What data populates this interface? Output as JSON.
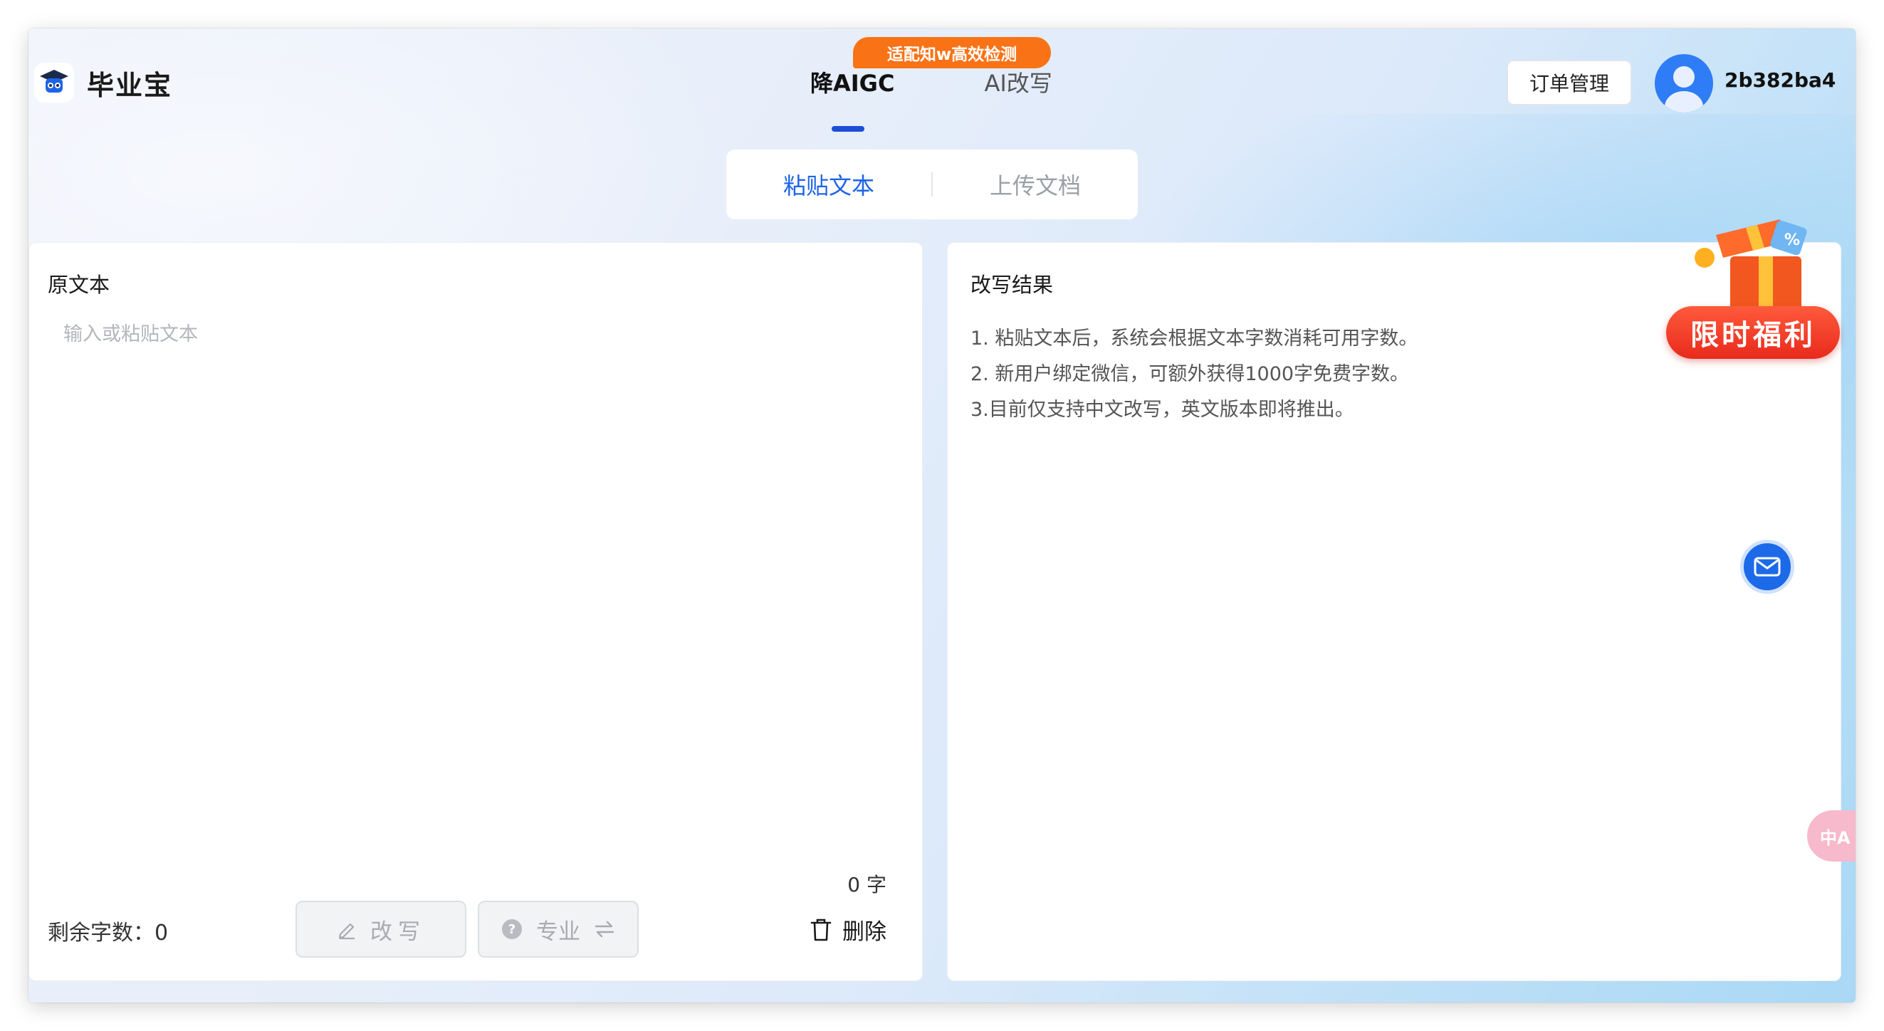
{
  "header": {
    "logo_text": "毕业宝",
    "nav": [
      {
        "label": "降AIGC",
        "active": true
      },
      {
        "label": "AI改写",
        "active": false
      }
    ],
    "promo_badge": "适配知w高效检测",
    "order_button": "订单管理",
    "username": "2b382ba4"
  },
  "mode_switch": {
    "paste": "粘贴文本",
    "upload": "上传文档",
    "active": "paste"
  },
  "left_panel": {
    "title": "原文本",
    "placeholder": "输入或粘贴文本",
    "char_count": "0 字",
    "remaining": "剩余字数：0",
    "rewrite_button": "改写",
    "pro_button": "专业",
    "delete_button": "删除"
  },
  "right_panel": {
    "title": "改写结果",
    "instructions": [
      "1. 粘贴文本后，系统会根据文本字数消耗可用字数。",
      "2. 新用户绑定微信，可额外获得1000字免费字数。",
      "3.目前仅支持中文改写，英文版本即将推出。"
    ]
  },
  "floating": {
    "gift_label": "限时福利",
    "translate_label": "中A"
  },
  "colors": {
    "accent": "#1d64e8",
    "promo": "#f97316",
    "gift_red": "#e82a1c"
  }
}
